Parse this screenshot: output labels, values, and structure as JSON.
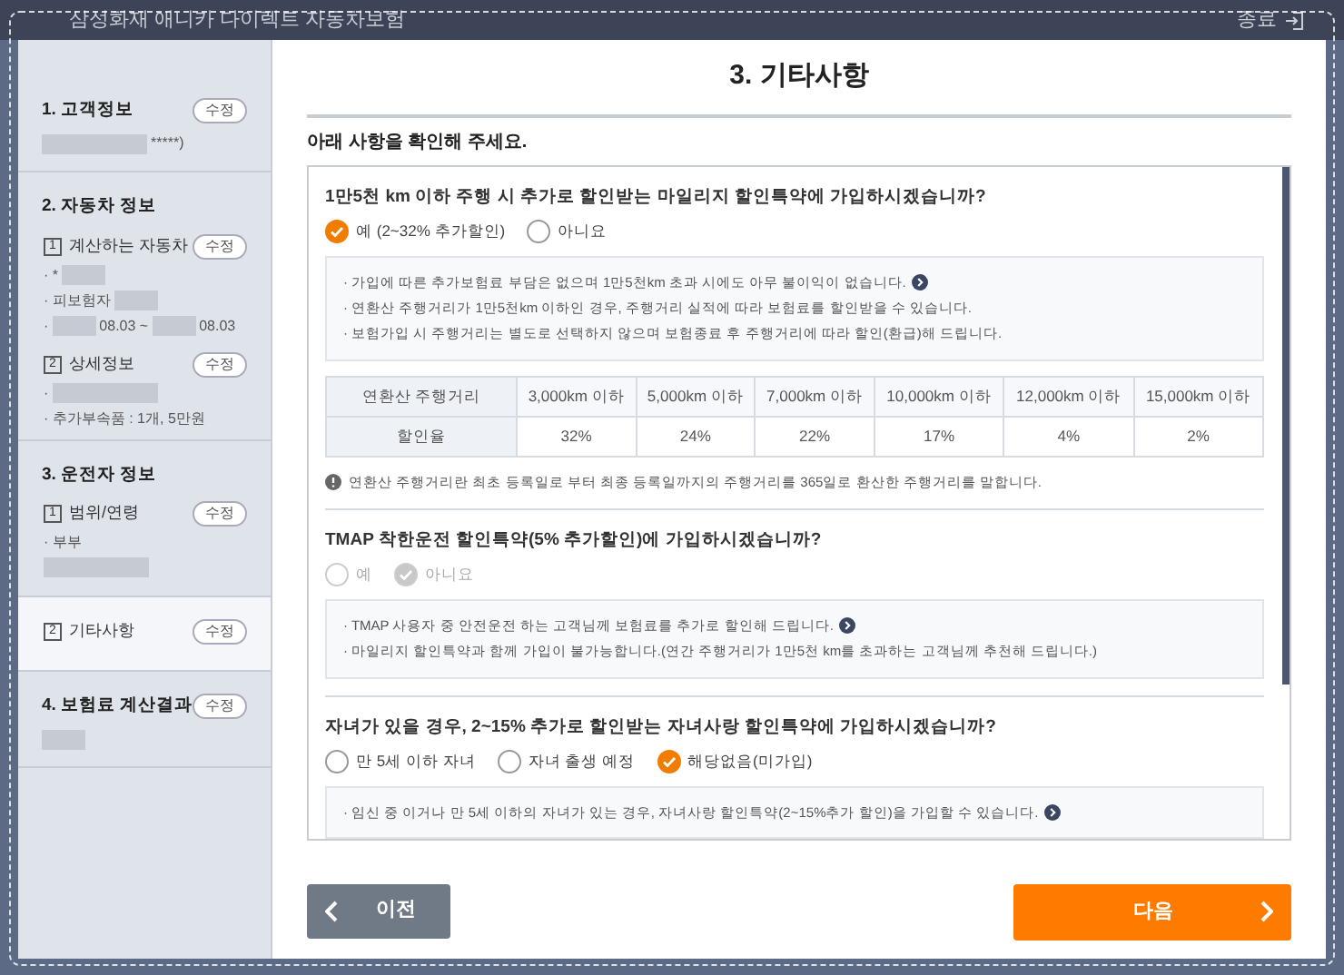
{
  "window": {
    "title": "삼성화재 애니카 다이렉트 자동차보험",
    "close_label": "종료"
  },
  "sidebar": {
    "sections": [
      {
        "title": "1. 고객정보",
        "edit": "수정",
        "lines": [
          [
            {
              "kind": "blur_long"
            },
            {
              "kind": "text",
              "text": "*****)"
            }
          ]
        ]
      },
      {
        "title": "2. 자동차 정보",
        "subsections": [
          {
            "number": "1",
            "title": "계산하는 자동차",
            "edit": "수정",
            "selected": false,
            "lines": [
              [
                {
                  "kind": "text",
                  "text": "· *"
                },
                {
                  "kind": "blur_short"
                }
              ],
              [
                {
                  "kind": "text",
                  "text": "· 피보험자"
                },
                {
                  "kind": "blur_short"
                }
              ],
              [
                {
                  "kind": "text",
                  "text": "·"
                },
                {
                  "kind": "blur_short"
                },
                {
                  "kind": "text",
                  "text": "08.03 ~"
                },
                {
                  "kind": "blur_short"
                },
                {
                  "kind": "text",
                  "text": "08.03"
                }
              ]
            ]
          },
          {
            "number": "2",
            "title": "상세정보",
            "edit": "수정",
            "selected": false,
            "lines": [
              [
                {
                  "kind": "text",
                  "text": "·"
                },
                {
                  "kind": "blur_long"
                }
              ],
              [
                {
                  "kind": "text",
                  "text": "· 추가부속품 : 1개, 5만원"
                }
              ]
            ]
          }
        ]
      },
      {
        "title": "3. 운전자 정보",
        "subsections": [
          {
            "number": "1",
            "title": "범위/연령",
            "edit": "수정",
            "selected": false,
            "lines": [
              [
                {
                  "kind": "text",
                  "text": "· 부부"
                }
              ],
              [
                {
                  "kind": "blur_long"
                }
              ]
            ]
          },
          {
            "number": "2",
            "title": "기타사항",
            "edit": "수정",
            "selected": true
          }
        ]
      },
      {
        "title": "4. 보험료 계산결과",
        "edit": "수정",
        "lines": [
          [
            {
              "kind": "blur_short"
            }
          ]
        ]
      }
    ]
  },
  "main": {
    "title": "3. 기타사항",
    "intro": "아래 사항을 확인해 주세요.",
    "questions": [
      {
        "question": "1만5천 km 이하 주행 시 추가로 할인받는 마일리지 할인특약에 가입하시겠습니까?",
        "disabled": false,
        "options": [
          {
            "label": "예 (2~32% 추가할인)",
            "selected": true
          },
          {
            "label": "아니요",
            "selected": false
          }
        ],
        "notes": [
          {
            "text": "· 가입에 따른 추가보험료 부담은 없으며 1만5천km 초과 시에도 아무 불이익이 없습니다.",
            "more": true
          },
          {
            "text": "· 연환산 주행거리가 1만5천km 이하인 경우, 주행거리 실적에 따라 보험료를 할인받을 수 있습니다.",
            "more": false
          },
          {
            "text": "· 보험가입 시 주행거리는 별도로 선택하지 않으며 보험종료 후 주행거리에 따라 할인(환급)해 드립니다.",
            "more": false
          }
        ],
        "table": {
          "columns": [
            "연환산 주행거리",
            "3,000km 이하",
            "5,000km 이하",
            "7,000km 이하",
            "10,000km 이하",
            "12,000km 이하",
            "15,000km 이하"
          ],
          "rows": [
            [
              "할인율",
              "32%",
              "24%",
              "22%",
              "17%",
              "4%",
              "2%"
            ]
          ]
        },
        "footnote": "연환산 주행거리란 최초 등록일로 부터 최종 등록일까지의 주행거리를 365일로 환산한 주행거리를 말합니다."
      },
      {
        "question": "TMAP 착한운전 할인특약(5% 추가할인)에 가입하시겠습니까?",
        "disabled": true,
        "options": [
          {
            "label": "예",
            "selected": false
          },
          {
            "label": "아니요",
            "selected": true
          }
        ],
        "notes": [
          {
            "text": "· TMAP 사용자 중 안전운전 하는 고객님께 보험료를 추가로 할인해 드립니다.",
            "more": true
          },
          {
            "text": "· 마일리지 할인특약과 함께 가입이 불가능합니다.(연간 주행거리가 1만5천 km를 초과하는 고객님께 추천해 드립니다.)",
            "more": false
          }
        ]
      },
      {
        "question": "자녀가 있을 경우, 2~15% 추가로 할인받는 자녀사랑 할인특약에 가입하시겠습니까?",
        "disabled": false,
        "options": [
          {
            "label": "만 5세 이하 자녀",
            "selected": false
          },
          {
            "label": "자녀 출생 예정",
            "selected": false
          },
          {
            "label": "해당없음(미가입)",
            "selected": true
          }
        ],
        "notes": [
          {
            "text": "· 임신 중 이거나 만 5세 이하의 자녀가 있는 경우, 자녀사랑 할인특약(2~15%추가 할인)을 가입할 수 있습니다.",
            "more": true
          }
        ]
      }
    ]
  },
  "buttons": {
    "prev": "이전",
    "next": "다음"
  }
}
